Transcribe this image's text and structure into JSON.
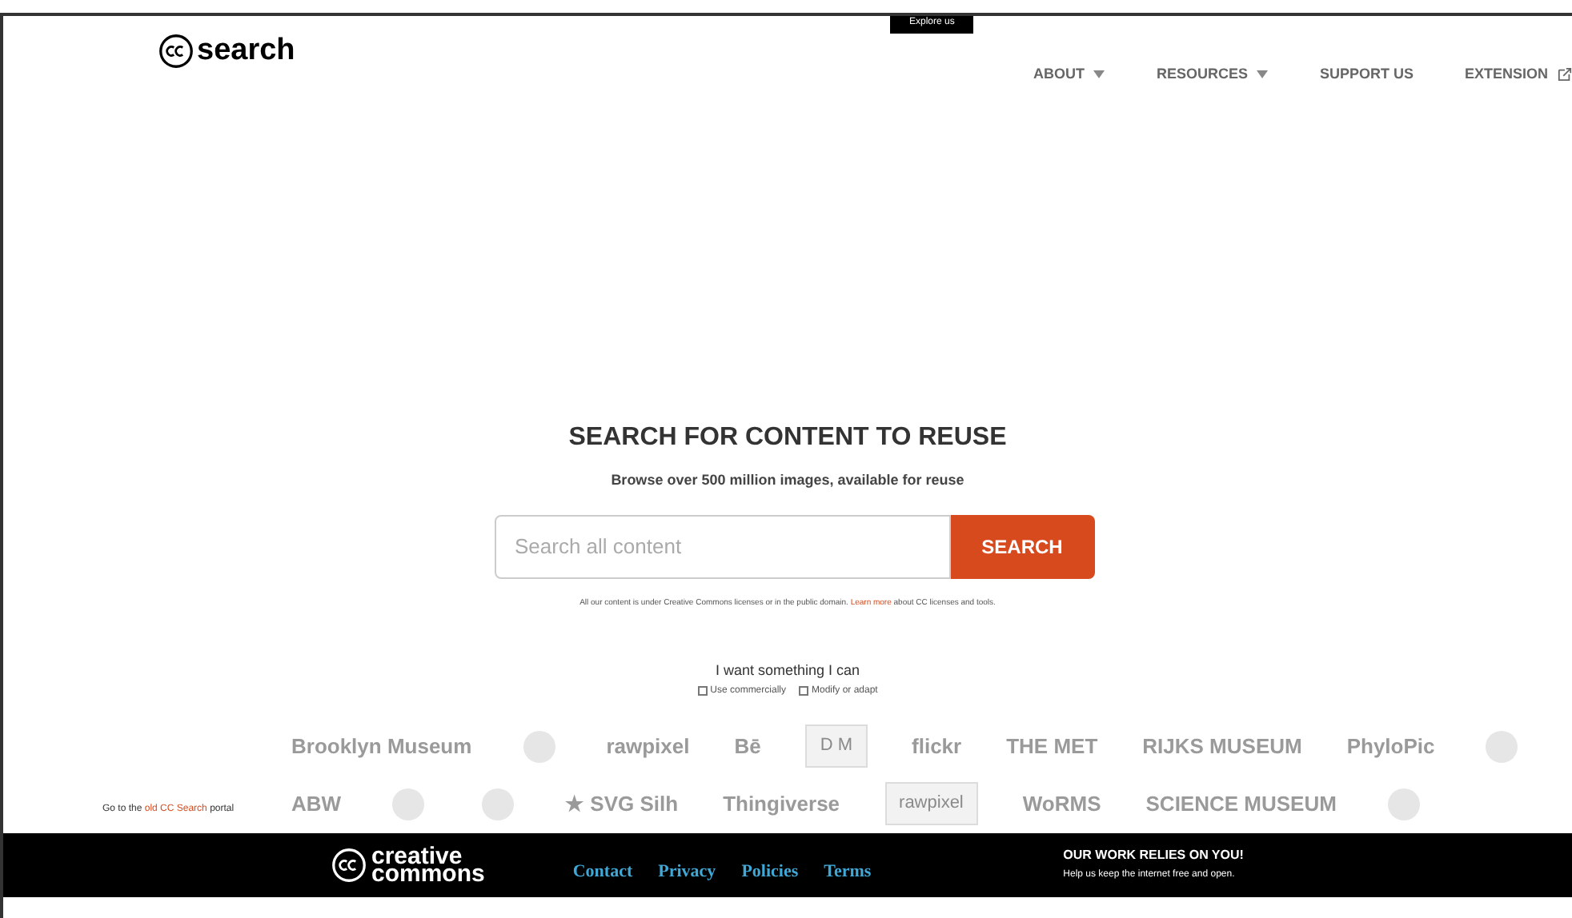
{
  "header": {
    "logo": "search",
    "explore_tab": "Explore us",
    "nav": [
      {
        "label": "ABOUT",
        "dropdown": true,
        "external": false
      },
      {
        "label": "RESOURCES",
        "dropdown": true,
        "external": false
      },
      {
        "label": "SUPPORT US",
        "dropdown": false,
        "external": false
      },
      {
        "label": "EXTENSION",
        "dropdown": false,
        "external": true
      }
    ]
  },
  "hero": {
    "title": "SEARCH FOR CONTENT TO REUSE",
    "subtitle": "Browse over 500 million images, available for reuse",
    "search": {
      "placeholder": "Search all content",
      "button": "SEARCH"
    },
    "note": {
      "before": "All our content is under Creative Commons licenses or in the public domain.",
      "link": "Learn more",
      "after": "about CC licenses and tools."
    },
    "filters": {
      "title": "I want something I can",
      "options": [
        {
          "label": "Use commercially",
          "checked": false
        },
        {
          "label": "Modify or adapt",
          "checked": false
        }
      ]
    }
  },
  "old_portal": {
    "before": "Go to the",
    "link": "old CC Search",
    "after": "portal"
  },
  "partners": [
    [
      {
        "kind": "text",
        "label": "Brooklyn Museum"
      },
      {
        "kind": "icon"
      },
      {
        "kind": "text",
        "label": "rawpixel"
      },
      {
        "kind": "text",
        "label": "Bē"
      },
      {
        "kind": "boxed",
        "label": "D M"
      },
      {
        "kind": "text",
        "label": "flickr"
      },
      {
        "kind": "text",
        "label": "THE MET"
      },
      {
        "kind": "text",
        "label": "RIJKS MUSEUM"
      },
      {
        "kind": "text",
        "label": "PhyloPic"
      },
      {
        "kind": "icon"
      }
    ],
    [
      {
        "kind": "text",
        "label": "ABW"
      },
      {
        "kind": "icon"
      },
      {
        "kind": "icon"
      },
      {
        "kind": "text",
        "label": "★ SVG Silh"
      },
      {
        "kind": "text",
        "label": "Thingiverse"
      },
      {
        "kind": "boxed",
        "label": "rawpixel"
      },
      {
        "kind": "text",
        "label": "WoRMS"
      },
      {
        "kind": "text",
        "label": "SCIENCE MUSEUM"
      },
      {
        "kind": "icon"
      }
    ]
  ],
  "footer": {
    "logo_top": "creative",
    "logo_bottom": "commons",
    "links": [
      "Contact",
      "Privacy",
      "Policies",
      "Terms"
    ],
    "cta_title": "OUR WORK RELIES ON YOU!",
    "cta_text": "Help us keep the internet free and open."
  }
}
